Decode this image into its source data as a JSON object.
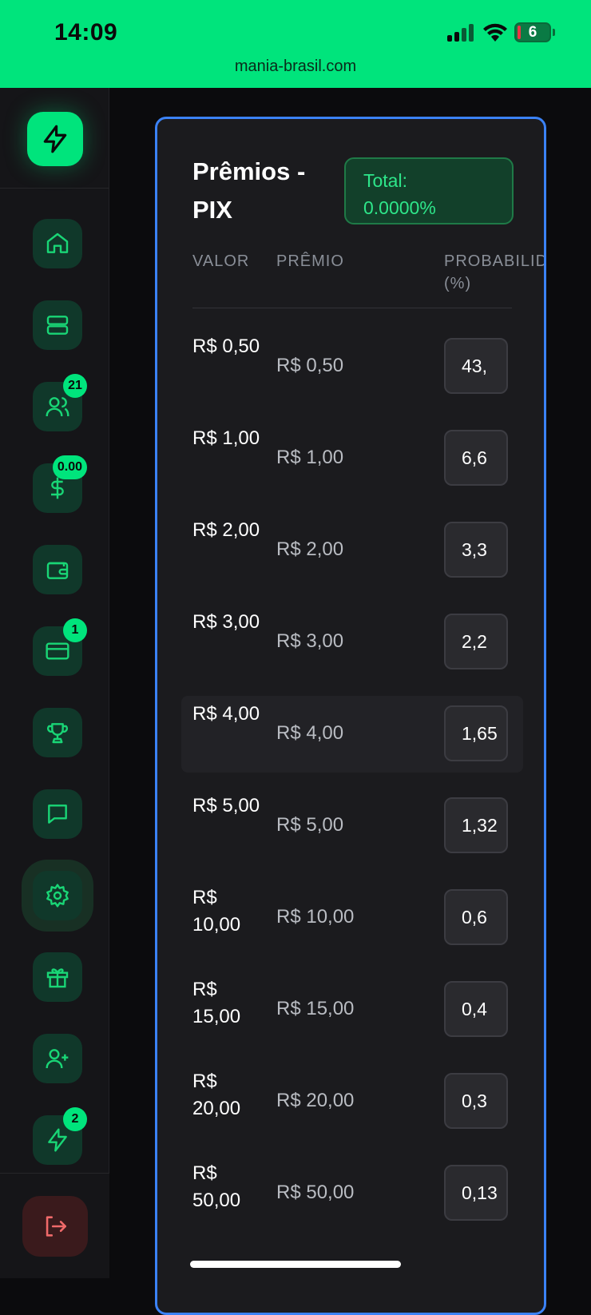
{
  "status_bar": {
    "time": "14:09",
    "url": "mania-brasil.com",
    "battery": "6"
  },
  "sidebar": {
    "items": [
      {
        "icon": "home-icon",
        "badge": ""
      },
      {
        "icon": "server-icon",
        "badge": ""
      },
      {
        "icon": "users-icon",
        "badge": "21"
      },
      {
        "icon": "dollar-icon",
        "badge": "0.00"
      },
      {
        "icon": "wallet-icon",
        "badge": ""
      },
      {
        "icon": "credit-card-icon",
        "badge": "1"
      },
      {
        "icon": "trophy-icon",
        "badge": ""
      },
      {
        "icon": "chat-icon",
        "badge": ""
      },
      {
        "icon": "gear-icon",
        "badge": ""
      },
      {
        "icon": "gift-icon",
        "badge": ""
      },
      {
        "icon": "user-plus-icon",
        "badge": ""
      },
      {
        "icon": "lightning-icon",
        "badge": "2"
      }
    ],
    "active_item": "gear-icon"
  },
  "card": {
    "title": "Prêmios - PIX",
    "total_label": "Total:",
    "total_value": "0.0000%",
    "columns": {
      "valor": "VALOR",
      "premio": "PRÊMIO",
      "probabilidade": "PROBABILIDADE (%)"
    },
    "rows": [
      {
        "valor": "R$ 0,50",
        "premio": "R$ 0,50",
        "prob": "43,"
      },
      {
        "valor": "R$ 1,00",
        "premio": "R$ 1,00",
        "prob": "6,6"
      },
      {
        "valor": "R$ 2,00",
        "premio": "R$ 2,00",
        "prob": "3,3"
      },
      {
        "valor": "R$ 3,00",
        "premio": "R$ 3,00",
        "prob": "2,2"
      },
      {
        "valor": "R$ 4,00",
        "premio": "R$ 4,00",
        "prob": "1,65"
      },
      {
        "valor": "R$ 5,00",
        "premio": "R$ 5,00",
        "prob": "1,32"
      },
      {
        "valor": "R$ 10,00",
        "premio": "R$ 10,00",
        "prob": "0,6"
      },
      {
        "valor": "R$ 15,00",
        "premio": "R$ 15,00",
        "prob": "0,4"
      },
      {
        "valor": "R$ 20,00",
        "premio": "R$ 20,00",
        "prob": "0,3"
      },
      {
        "valor": "R$ 50,00",
        "premio": "R$ 50,00",
        "prob": "0,13"
      }
    ],
    "highlighted_row": 4
  },
  "colors": {
    "accent": "#00e47c",
    "card_border": "#3b82f6",
    "background": "#0b0b0d"
  }
}
